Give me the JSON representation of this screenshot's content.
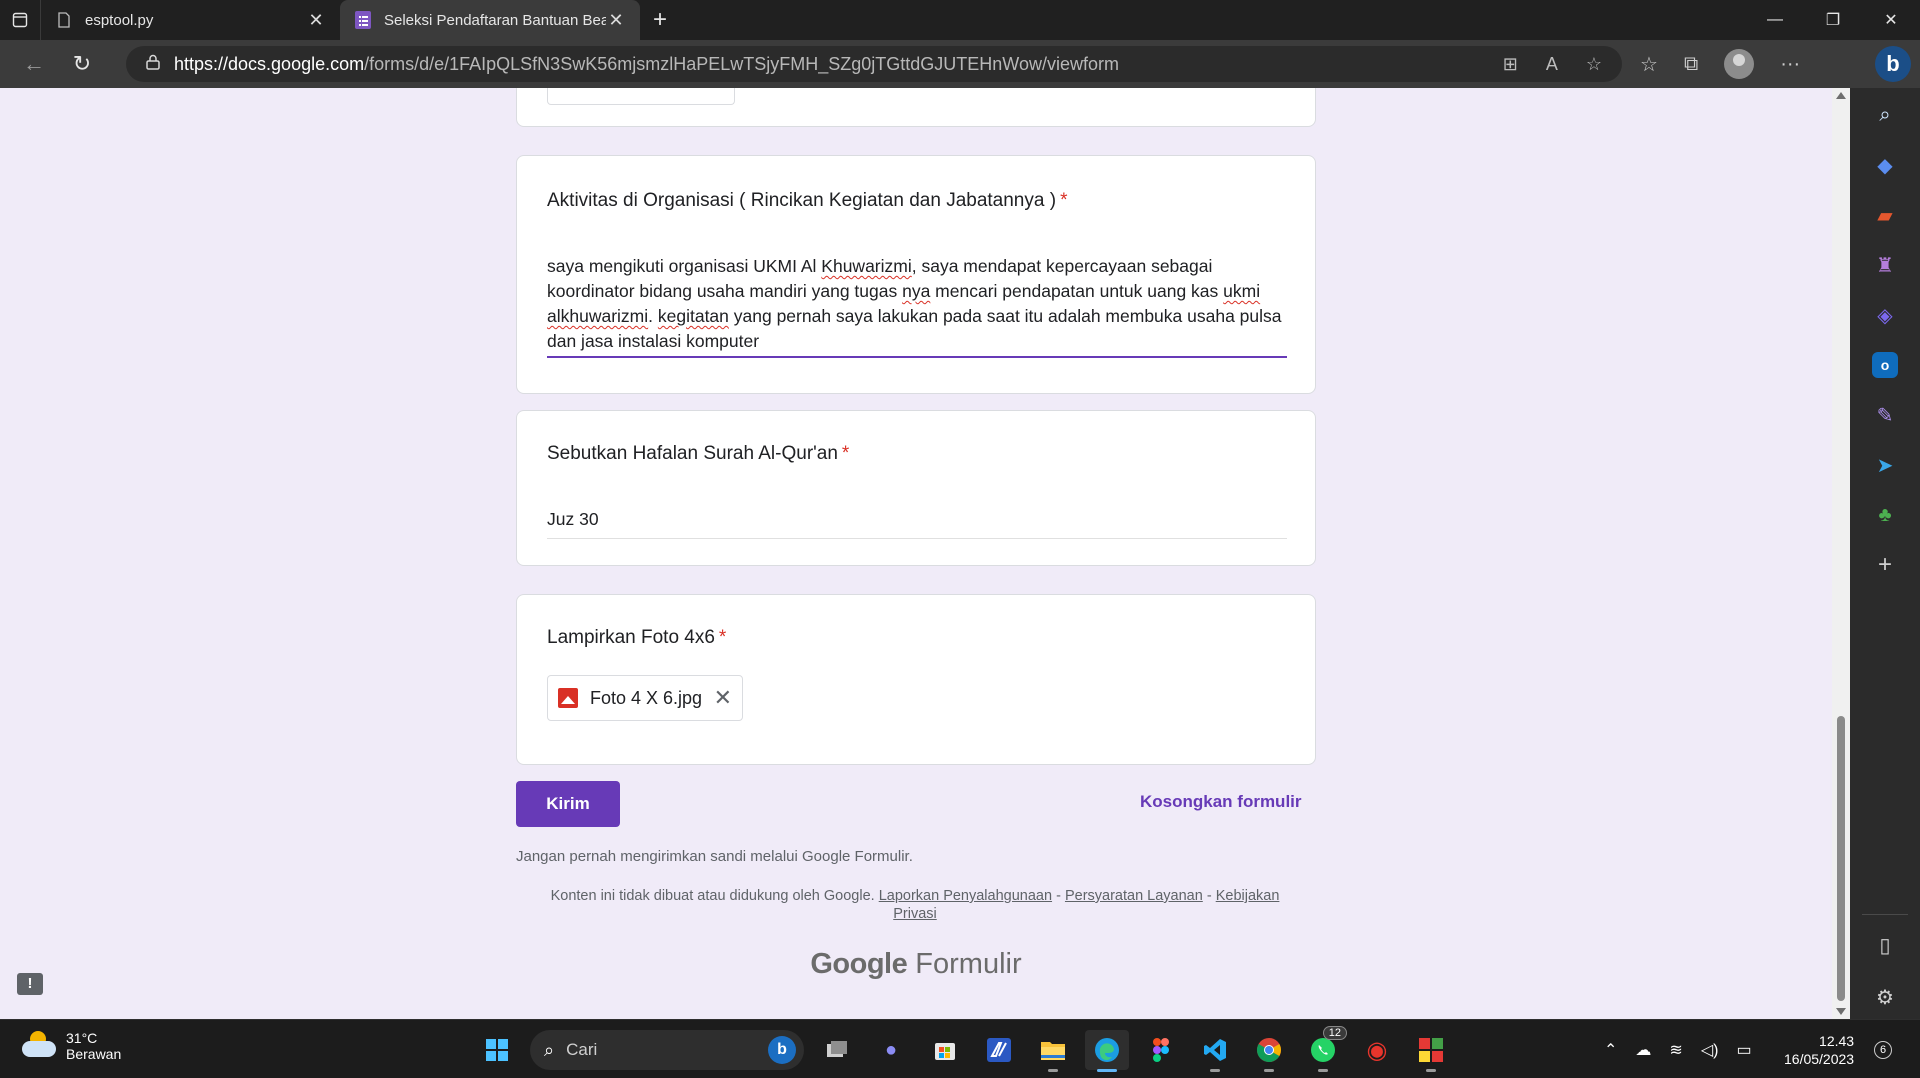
{
  "browser": {
    "tabs": [
      {
        "title": "esptool.py",
        "active": false
      },
      {
        "title": "Seleksi Pendaftaran Bantuan Bea",
        "active": true
      }
    ],
    "url_host": "https://docs.google.com",
    "url_path": "/forms/d/e/1FAIpQLSfN3SwK56mjsmzlHaPELwTSjyFMH_SZg0jTGttdGJUTEHnWow/viewform"
  },
  "form": {
    "q1": {
      "title": "Aktivitas di Organisasi ( Rincikan Kegiatan dan Jabatannya )",
      "required_mark": "*",
      "answer_parts": [
        "saya mengikuti organisasi UKMI Al ",
        "Khuwarizmi",
        ", saya mendapat kepercayaan sebagai koordinator bidang usaha mandiri yang tugas ",
        "nya",
        " mencari pendapatan untuk uang kas ",
        "ukmi alkhuwarizmi",
        ". ",
        "kegitatan",
        " yang pernah saya lakukan pada saat itu adalah membuka usaha pulsa dan jasa instalasi komputer"
      ]
    },
    "q2": {
      "title": "Sebutkan Hafalan Surah Al-Qur'an",
      "required_mark": "*",
      "answer": "Juz 30"
    },
    "q3": {
      "title": "Lampirkan Foto 4x6",
      "required_mark": "*",
      "file_name": "Foto 4 X 6.jpg"
    },
    "submit_label": "Kirim",
    "clear_label": "Kosongkan formulir",
    "password_note": "Jangan pernah mengirimkan sandi melalui Google Formulir.",
    "legal_text": "Konten ini tidak dibuat atau didukung oleh Google.",
    "legal_links": [
      "Laporkan Penyalahgunaan",
      "Persyaratan Layanan",
      "Kebijakan Privasi"
    ],
    "legal_sep": "-",
    "brand_google": "Google",
    "brand_formulir": "Formulir"
  },
  "taskbar": {
    "weather_temp": "31°C",
    "weather_desc": "Berawan",
    "search_placeholder": "Cari",
    "whatsapp_badge": "12",
    "time": "12.43",
    "date": "16/05/2023",
    "notification_count": "6"
  },
  "colors": {
    "accent": "#673ab7",
    "page_bg": "#f0ebf8",
    "required": "#d93025"
  }
}
